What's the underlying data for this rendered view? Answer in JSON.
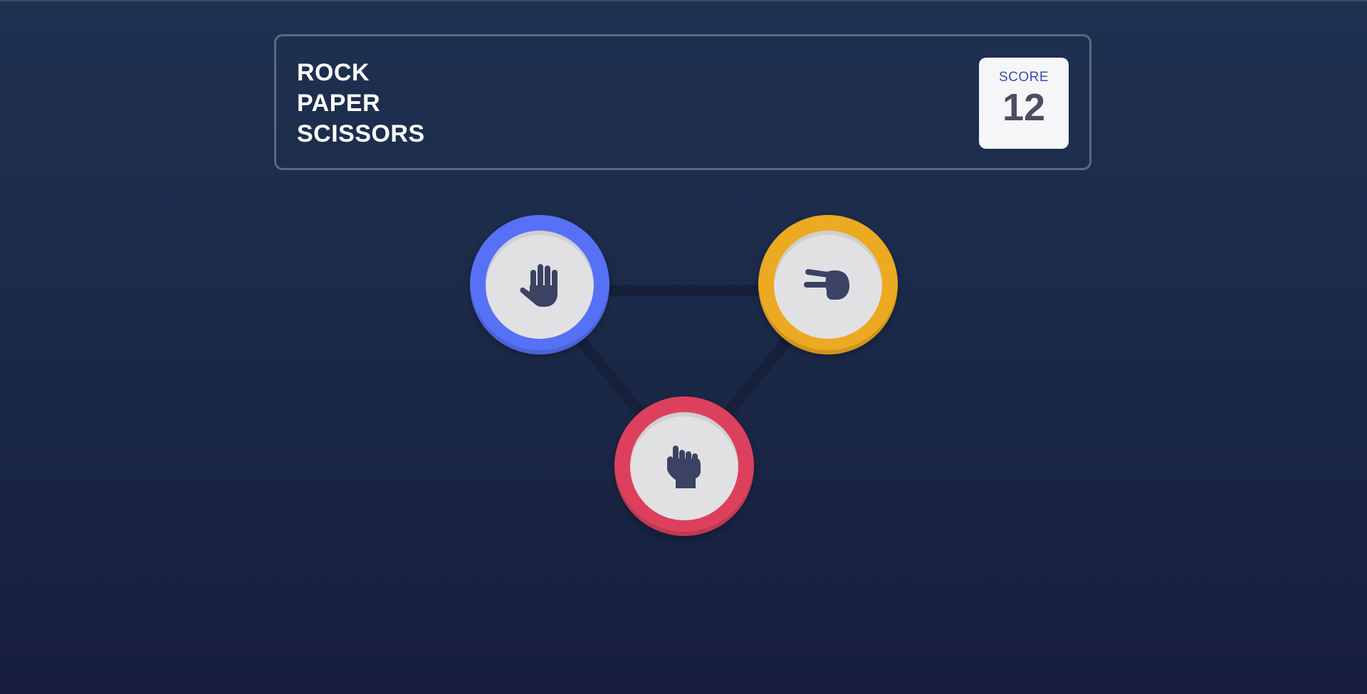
{
  "header": {
    "title_lines": [
      "ROCK",
      "PAPER",
      "SCISSORS"
    ],
    "score_label": "SCORE",
    "score_value": "12"
  },
  "choices": [
    {
      "id": "paper",
      "icon": "paper-hand-icon",
      "ring_color": "#5671f5"
    },
    {
      "id": "scissors",
      "icon": "scissors-hand-icon",
      "ring_color": "#eca922"
    },
    {
      "id": "rock",
      "icon": "rock-hand-icon",
      "ring_color": "#dd405d"
    }
  ],
  "colors": {
    "background_top": "#1f3150",
    "background_bottom": "#171e3d",
    "header_border": "#5b6a82",
    "icon_fill": "#3b4262"
  }
}
